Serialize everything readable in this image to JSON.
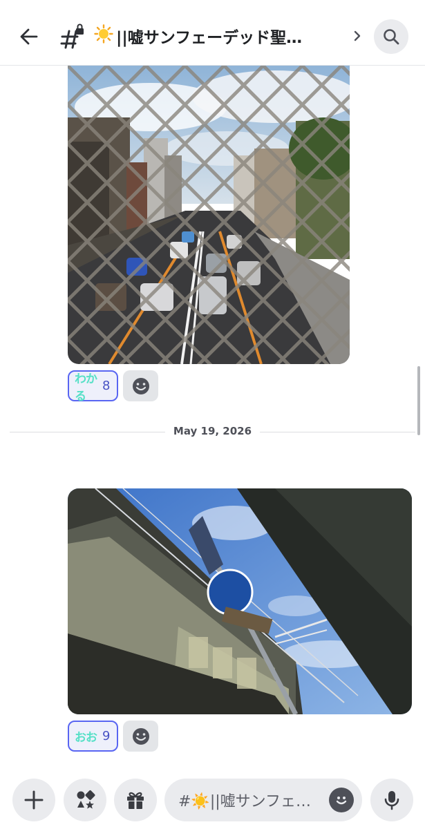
{
  "header": {
    "back_icon": "arrow-left-icon",
    "channel_icon": "locked-hash-icon",
    "sun_emoji": "☀️",
    "title": "||嘘サンフェーデッド聖…",
    "chevron_icon": "chevron-right-icon",
    "search_icon": "search-icon"
  },
  "messages": [
    {
      "image_alt": "Photo through a chain-link fence of a multi-lane road with cars",
      "reaction": {
        "emoji_text": "わかる",
        "count": "8"
      },
      "add_reaction_icon": "smiley-icon"
    },
    {
      "image_alt": "Photo looking up at a railway bridge with a blue road sign and sky",
      "reaction": {
        "emoji_text": "おお",
        "count": "9"
      },
      "add_reaction_icon": "smiley-icon"
    }
  ],
  "date_divider": "May 19, 2026",
  "composer": {
    "plus_icon": "plus-icon",
    "apps_icon": "apps-icon",
    "gift_icon": "gift-icon",
    "placeholder": "#☀️||嘘サンフェ…",
    "emoji_icon": "smiley-icon",
    "mic_icon": "microphone-icon"
  },
  "colors": {
    "accent": "#5865f2",
    "reaction_bg": "#eef0fb",
    "button_bg": "#eaebee",
    "reaction_text": "#57e0c7"
  }
}
